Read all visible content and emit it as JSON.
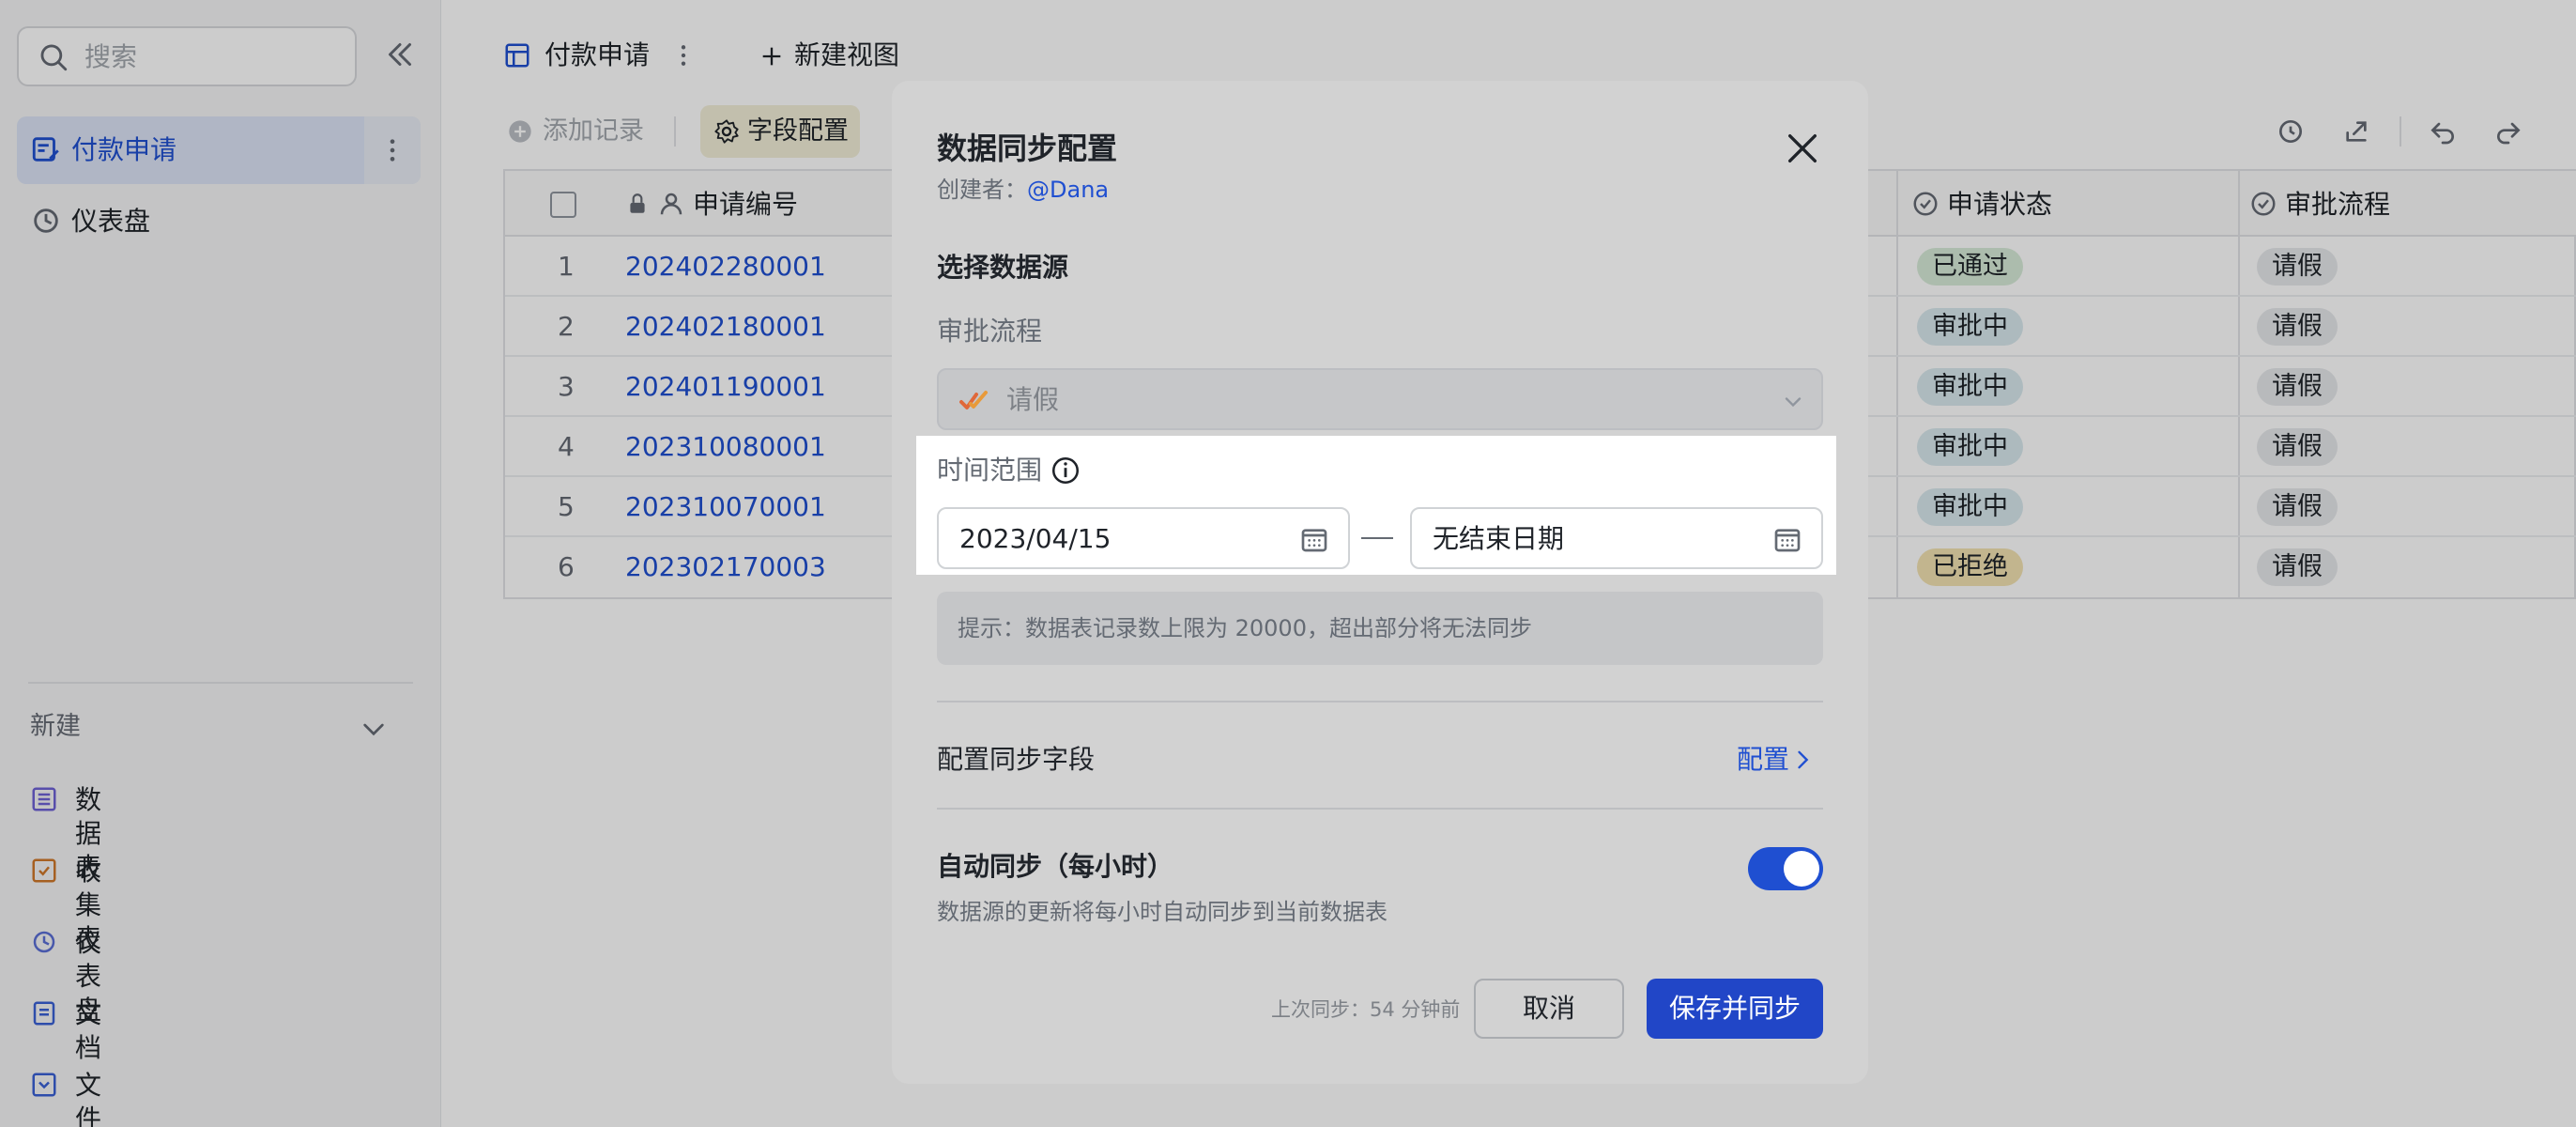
{
  "sidebar": {
    "search_placeholder": "搜索",
    "items": [
      {
        "label": "付款申请",
        "active": true
      },
      {
        "label": "仪表盘",
        "active": false
      }
    ],
    "new_label": "新建",
    "new_items": [
      {
        "label": "数据表",
        "icon": "table-icon"
      },
      {
        "label": "收集表",
        "icon": "form-icon"
      },
      {
        "label": "仪表盘",
        "icon": "dashboard-icon"
      },
      {
        "label": "文档",
        "icon": "doc-icon"
      },
      {
        "label": "文件夹",
        "icon": "folder-icon"
      }
    ]
  },
  "tabs": {
    "current": "付款申请",
    "new_view": "新建视图"
  },
  "toolbar": {
    "add_record": "添加记录",
    "field_config": "字段配置"
  },
  "table": {
    "columns": [
      "申请编号",
      "申请状态",
      "审批流程"
    ],
    "rows": [
      {
        "num": "1",
        "id": "202402280001",
        "status": "已通过",
        "flow": "请假"
      },
      {
        "num": "2",
        "id": "202402180001",
        "status": "审批中",
        "flow": "请假"
      },
      {
        "num": "3",
        "id": "202401190001",
        "status": "审批中",
        "flow": "请假"
      },
      {
        "num": "4",
        "id": "202310080001",
        "status": "审批中",
        "flow": "请假"
      },
      {
        "num": "5",
        "id": "202310070001",
        "status": "审批中",
        "flow": "请假"
      },
      {
        "num": "6",
        "id": "202302170003",
        "status": "已拒绝",
        "flow": "请假"
      }
    ]
  },
  "modal": {
    "title": "数据同步配置",
    "creator_prefix": "创建者：",
    "creator": "@Dana",
    "source_label": "选择数据源",
    "flow_label": "审批流程",
    "flow_value": "请假",
    "time_label": "时间范围",
    "start_date": "2023/04/15",
    "end_date": "无结束日期",
    "hint": "提示：数据表记录数上限为 20000，超出部分将无法同步",
    "config_fields_label": "配置同步字段",
    "config_link": "配置",
    "auto_sync_label": "自动同步（每小时）",
    "auto_sync_desc": "数据源的更新将每小时自动同步到当前数据表",
    "auto_sync_on": true,
    "last_sync": "上次同步：54 分钟前",
    "cancel": "取消",
    "save": "保存并同步"
  },
  "colors": {
    "accent": "#1f4fd1",
    "status_approved": "#d8ecd9",
    "status_pending": "#d9e9ee",
    "status_rejected": "#f3e3b2"
  }
}
